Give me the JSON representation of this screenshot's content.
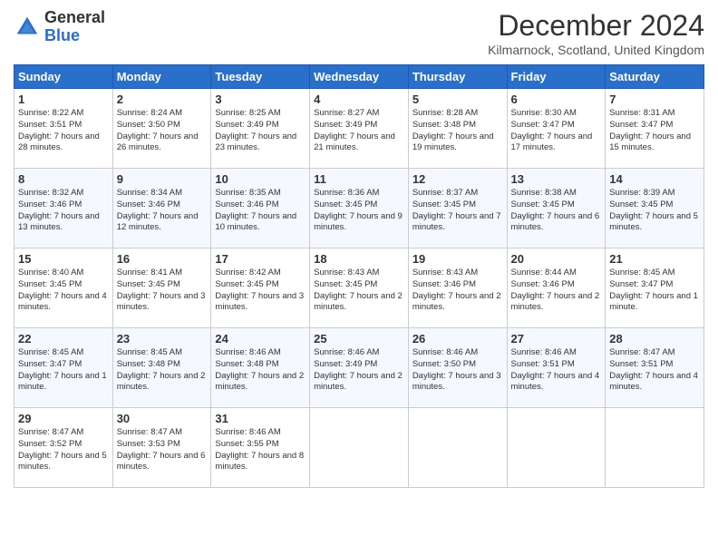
{
  "header": {
    "logo_general": "General",
    "logo_blue": "Blue",
    "month_title": "December 2024",
    "location": "Kilmarnock, Scotland, United Kingdom"
  },
  "columns": [
    "Sunday",
    "Monday",
    "Tuesday",
    "Wednesday",
    "Thursday",
    "Friday",
    "Saturday"
  ],
  "weeks": [
    [
      {
        "day": "1",
        "sunrise": "Sunrise: 8:22 AM",
        "sunset": "Sunset: 3:51 PM",
        "daylight": "Daylight: 7 hours and 28 minutes."
      },
      {
        "day": "2",
        "sunrise": "Sunrise: 8:24 AM",
        "sunset": "Sunset: 3:50 PM",
        "daylight": "Daylight: 7 hours and 26 minutes."
      },
      {
        "day": "3",
        "sunrise": "Sunrise: 8:25 AM",
        "sunset": "Sunset: 3:49 PM",
        "daylight": "Daylight: 7 hours and 23 minutes."
      },
      {
        "day": "4",
        "sunrise": "Sunrise: 8:27 AM",
        "sunset": "Sunset: 3:49 PM",
        "daylight": "Daylight: 7 hours and 21 minutes."
      },
      {
        "day": "5",
        "sunrise": "Sunrise: 8:28 AM",
        "sunset": "Sunset: 3:48 PM",
        "daylight": "Daylight: 7 hours and 19 minutes."
      },
      {
        "day": "6",
        "sunrise": "Sunrise: 8:30 AM",
        "sunset": "Sunset: 3:47 PM",
        "daylight": "Daylight: 7 hours and 17 minutes."
      },
      {
        "day": "7",
        "sunrise": "Sunrise: 8:31 AM",
        "sunset": "Sunset: 3:47 PM",
        "daylight": "Daylight: 7 hours and 15 minutes."
      }
    ],
    [
      {
        "day": "8",
        "sunrise": "Sunrise: 8:32 AM",
        "sunset": "Sunset: 3:46 PM",
        "daylight": "Daylight: 7 hours and 13 minutes."
      },
      {
        "day": "9",
        "sunrise": "Sunrise: 8:34 AM",
        "sunset": "Sunset: 3:46 PM",
        "daylight": "Daylight: 7 hours and 12 minutes."
      },
      {
        "day": "10",
        "sunrise": "Sunrise: 8:35 AM",
        "sunset": "Sunset: 3:46 PM",
        "daylight": "Daylight: 7 hours and 10 minutes."
      },
      {
        "day": "11",
        "sunrise": "Sunrise: 8:36 AM",
        "sunset": "Sunset: 3:45 PM",
        "daylight": "Daylight: 7 hours and 9 minutes."
      },
      {
        "day": "12",
        "sunrise": "Sunrise: 8:37 AM",
        "sunset": "Sunset: 3:45 PM",
        "daylight": "Daylight: 7 hours and 7 minutes."
      },
      {
        "day": "13",
        "sunrise": "Sunrise: 8:38 AM",
        "sunset": "Sunset: 3:45 PM",
        "daylight": "Daylight: 7 hours and 6 minutes."
      },
      {
        "day": "14",
        "sunrise": "Sunrise: 8:39 AM",
        "sunset": "Sunset: 3:45 PM",
        "daylight": "Daylight: 7 hours and 5 minutes."
      }
    ],
    [
      {
        "day": "15",
        "sunrise": "Sunrise: 8:40 AM",
        "sunset": "Sunset: 3:45 PM",
        "daylight": "Daylight: 7 hours and 4 minutes."
      },
      {
        "day": "16",
        "sunrise": "Sunrise: 8:41 AM",
        "sunset": "Sunset: 3:45 PM",
        "daylight": "Daylight: 7 hours and 3 minutes."
      },
      {
        "day": "17",
        "sunrise": "Sunrise: 8:42 AM",
        "sunset": "Sunset: 3:45 PM",
        "daylight": "Daylight: 7 hours and 3 minutes."
      },
      {
        "day": "18",
        "sunrise": "Sunrise: 8:43 AM",
        "sunset": "Sunset: 3:45 PM",
        "daylight": "Daylight: 7 hours and 2 minutes."
      },
      {
        "day": "19",
        "sunrise": "Sunrise: 8:43 AM",
        "sunset": "Sunset: 3:46 PM",
        "daylight": "Daylight: 7 hours and 2 minutes."
      },
      {
        "day": "20",
        "sunrise": "Sunrise: 8:44 AM",
        "sunset": "Sunset: 3:46 PM",
        "daylight": "Daylight: 7 hours and 2 minutes."
      },
      {
        "day": "21",
        "sunrise": "Sunrise: 8:45 AM",
        "sunset": "Sunset: 3:47 PM",
        "daylight": "Daylight: 7 hours and 1 minute."
      }
    ],
    [
      {
        "day": "22",
        "sunrise": "Sunrise: 8:45 AM",
        "sunset": "Sunset: 3:47 PM",
        "daylight": "Daylight: 7 hours and 1 minute."
      },
      {
        "day": "23",
        "sunrise": "Sunrise: 8:45 AM",
        "sunset": "Sunset: 3:48 PM",
        "daylight": "Daylight: 7 hours and 2 minutes."
      },
      {
        "day": "24",
        "sunrise": "Sunrise: 8:46 AM",
        "sunset": "Sunset: 3:48 PM",
        "daylight": "Daylight: 7 hours and 2 minutes."
      },
      {
        "day": "25",
        "sunrise": "Sunrise: 8:46 AM",
        "sunset": "Sunset: 3:49 PM",
        "daylight": "Daylight: 7 hours and 2 minutes."
      },
      {
        "day": "26",
        "sunrise": "Sunrise: 8:46 AM",
        "sunset": "Sunset: 3:50 PM",
        "daylight": "Daylight: 7 hours and 3 minutes."
      },
      {
        "day": "27",
        "sunrise": "Sunrise: 8:46 AM",
        "sunset": "Sunset: 3:51 PM",
        "daylight": "Daylight: 7 hours and 4 minutes."
      },
      {
        "day": "28",
        "sunrise": "Sunrise: 8:47 AM",
        "sunset": "Sunset: 3:51 PM",
        "daylight": "Daylight: 7 hours and 4 minutes."
      }
    ],
    [
      {
        "day": "29",
        "sunrise": "Sunrise: 8:47 AM",
        "sunset": "Sunset: 3:52 PM",
        "daylight": "Daylight: 7 hours and 5 minutes."
      },
      {
        "day": "30",
        "sunrise": "Sunrise: 8:47 AM",
        "sunset": "Sunset: 3:53 PM",
        "daylight": "Daylight: 7 hours and 6 minutes."
      },
      {
        "day": "31",
        "sunrise": "Sunrise: 8:46 AM",
        "sunset": "Sunset: 3:55 PM",
        "daylight": "Daylight: 7 hours and 8 minutes."
      },
      null,
      null,
      null,
      null
    ]
  ]
}
